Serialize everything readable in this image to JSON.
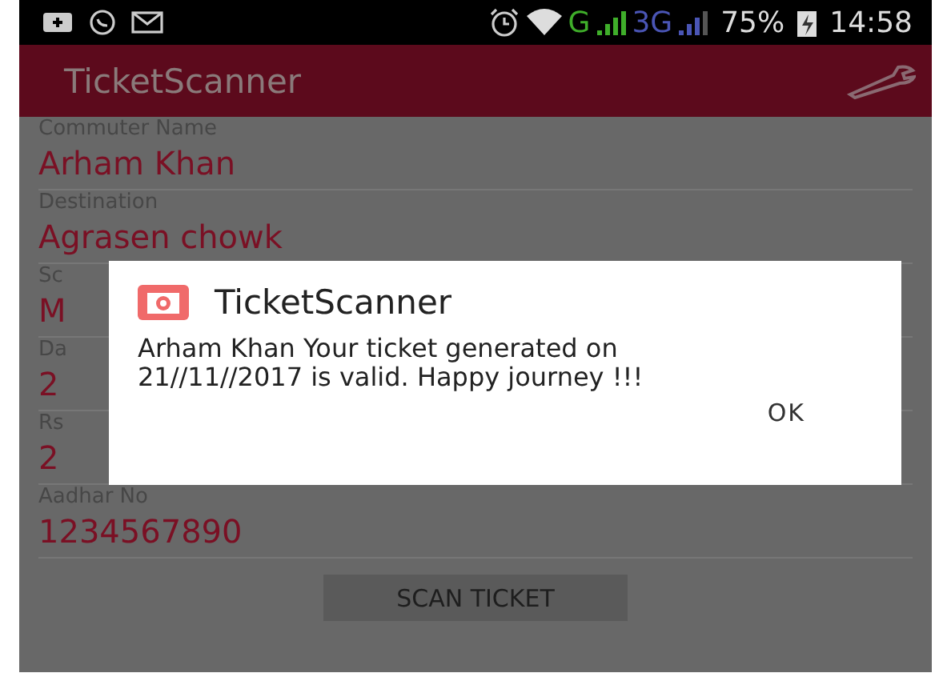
{
  "status_bar": {
    "network_g": "G",
    "network_3g": "3G",
    "battery": "75%",
    "time": "14:58"
  },
  "app_bar": {
    "title": "TicketScanner"
  },
  "fields": [
    {
      "label": "Commuter Name",
      "value": "Arham Khan"
    },
    {
      "label": "Destination",
      "value": "Agrasen chowk"
    },
    {
      "label": "Sc",
      "value": "M"
    },
    {
      "label": "Da",
      "value": "2"
    },
    {
      "label": "Rs",
      "value": "2"
    },
    {
      "label": "Aadhar No",
      "value": "1234567890"
    }
  ],
  "button": "SCAN TICKET",
  "dialog": {
    "title": "TicketScanner",
    "message": "Arham Khan Your ticket generated on  21//11//2017 is valid. Happy journey !!!",
    "button": "OK"
  }
}
